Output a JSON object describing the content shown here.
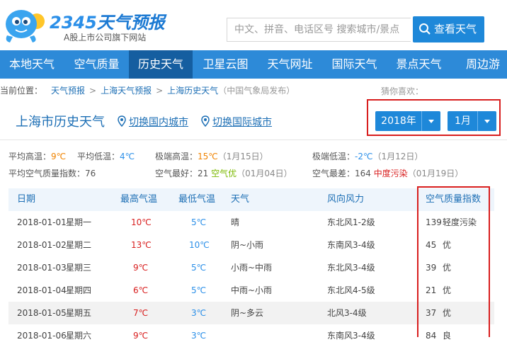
{
  "header": {
    "logo_main": "2345",
    "logo_cn": "天气预报",
    "logo_sub": "A股上市公司旗下网站",
    "search_placeholder": "中文、拼音、电话区号 搜索城市/景点",
    "search_button": "查看天气"
  },
  "nav": {
    "items": [
      "本地天气",
      "空气质量",
      "历史天气",
      "卫星云图",
      "天气网址",
      "国际天气",
      "景点天气",
      "周边游"
    ],
    "active_index": 2
  },
  "breadcrumb": {
    "prefix": "当前位置：",
    "items": [
      "天气预报",
      "上海天气预报",
      "上海历史天气"
    ],
    "source": "（中国气象局发布）"
  },
  "guess_label": "猜你喜欢：",
  "title": {
    "text": "上海市历史天气",
    "switch_domestic": "切换国内城市",
    "switch_intl": "切换国际城市"
  },
  "selectors": {
    "year": "2018年",
    "month": "1月"
  },
  "stats": {
    "avg_high_label": "平均高温：",
    "avg_high": "9℃",
    "avg_low_label": "平均低温：",
    "avg_low": "4℃",
    "max_high_label": "极端高温：",
    "max_high": "15℃",
    "max_high_date": "（1月15日）",
    "min_low_label": "极端低温：",
    "min_low": "-2℃",
    "min_low_date": "（1月12日）",
    "avg_aqi_label": "平均空气质量指数：",
    "avg_aqi": "76",
    "best_aqi_label": "空气最好：",
    "best_aqi": "21",
    "best_aqi_level": "空气优",
    "best_aqi_date": "（01月04日）",
    "worst_aqi_label": "空气最差：",
    "worst_aqi": "164",
    "worst_aqi_level": "中度污染",
    "worst_aqi_date": "（01月19日）"
  },
  "table": {
    "headers": [
      "日期",
      "最高气温",
      "最低气温",
      "天气",
      "风向风力",
      "空气质量指数"
    ],
    "rows": [
      {
        "date": "2018-01-01",
        "weekday": "星期一",
        "high": "10℃",
        "low": "5℃",
        "weather": "晴",
        "wind": "东北风1-2级",
        "aqi": "139",
        "level": "轻度污染"
      },
      {
        "date": "2018-01-02",
        "weekday": "星期二",
        "high": "13℃",
        "low": "10℃",
        "weather": "阴~小雨",
        "wind": "东南风3-4级",
        "aqi": "45",
        "level": "优"
      },
      {
        "date": "2018-01-03",
        "weekday": "星期三",
        "high": "9℃",
        "low": "5℃",
        "weather": "小雨~中雨",
        "wind": "东北风3-4级",
        "aqi": "39",
        "level": "优"
      },
      {
        "date": "2018-01-04",
        "weekday": "星期四",
        "high": "6℃",
        "low": "5℃",
        "weather": "中雨~小雨",
        "wind": "东北风4-5级",
        "aqi": "21",
        "level": "优"
      },
      {
        "date": "2018-01-05",
        "weekday": "星期五",
        "high": "7℃",
        "low": "3℃",
        "weather": "阴~多云",
        "wind": "北风3-4级",
        "aqi": "37",
        "level": "优"
      },
      {
        "date": "2018-01-06",
        "weekday": "星期六",
        "high": "9℃",
        "low": "3℃",
        "weather": "",
        "wind": "东南风3-4级",
        "aqi": "84",
        "level": "良"
      }
    ]
  },
  "colors": {
    "brand_blue": "#2d8ad8",
    "nav_active": "#155ea0",
    "highlight_red": "#d81e1e",
    "good_green": "#7ab800",
    "moderate_orange": "#f08300"
  }
}
